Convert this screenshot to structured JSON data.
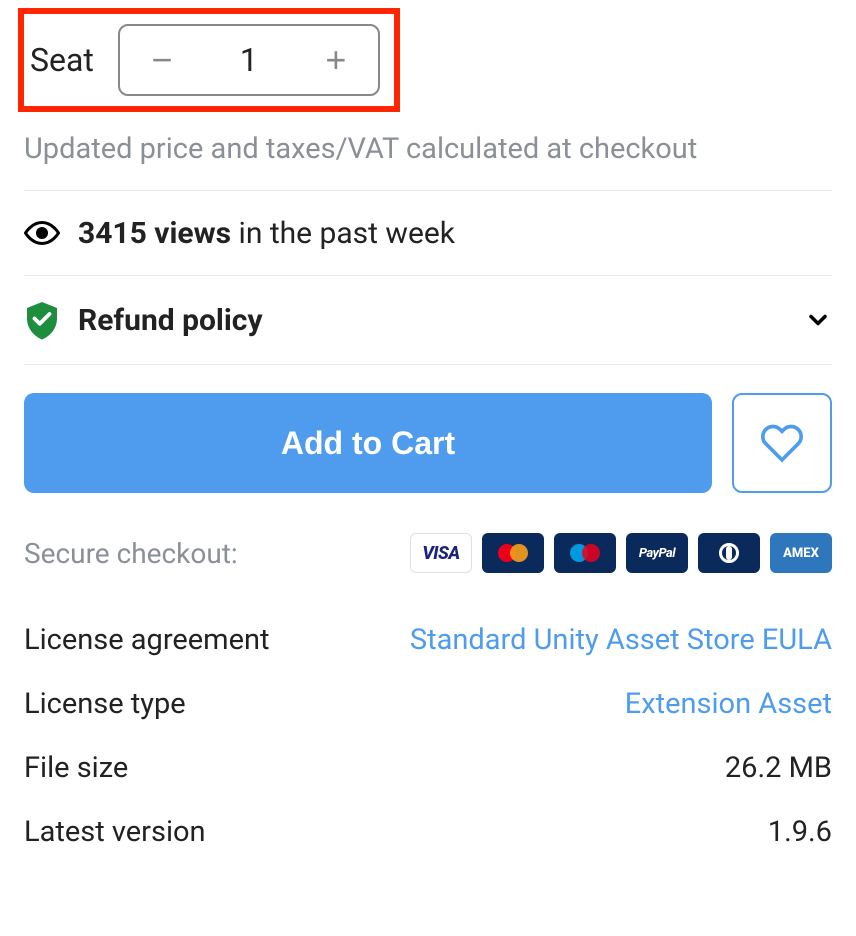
{
  "seat": {
    "label": "Seat",
    "value": "1"
  },
  "checkout_note": "Updated price and taxes/VAT calculated at checkout",
  "views": {
    "count_text": "3415 views",
    "suffix": " in the past week"
  },
  "refund": {
    "label": "Refund policy"
  },
  "actions": {
    "add_to_cart": "Add to Cart"
  },
  "secure": {
    "label": "Secure checkout:"
  },
  "payments": {
    "visa": "VISA",
    "paypal": "PayPal",
    "amex": "AMEX"
  },
  "details": {
    "license_agreement": {
      "label": "License agreement",
      "value": "Standard Unity Asset Store EULA"
    },
    "license_type": {
      "label": "License type",
      "value": "Extension Asset"
    },
    "file_size": {
      "label": "File size",
      "value": "26.2 MB"
    },
    "latest_version": {
      "label": "Latest version",
      "value": "1.9.6"
    }
  }
}
